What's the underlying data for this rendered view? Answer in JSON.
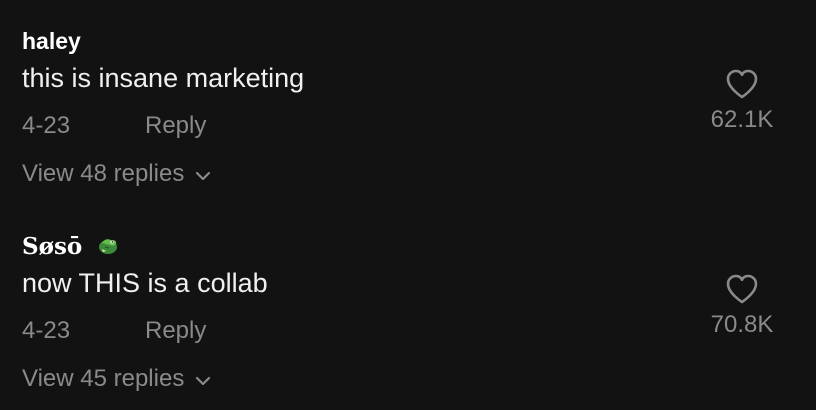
{
  "comments": [
    {
      "username": "haley",
      "text": "this is insane marketing",
      "date": "4-23",
      "reply_label": "Reply",
      "view_replies": "View 48 replies",
      "likes": "62.1K",
      "icons": {
        "like": "heart-outline-icon",
        "expand": "chevron-down-icon"
      }
    },
    {
      "username": "Søsō",
      "username_emoji": "🐊",
      "text": "now THIS is a collab",
      "date": "4-23",
      "reply_label": "Reply",
      "view_replies": "View 45 replies",
      "likes": "70.8K",
      "icons": {
        "like": "heart-outline-icon",
        "expand": "chevron-down-icon",
        "emoji": "crocodile-emoji-icon"
      }
    }
  ],
  "colors": {
    "background": "#121212",
    "primary_text": "#ffffff",
    "secondary_text": "#8a8a8a"
  }
}
